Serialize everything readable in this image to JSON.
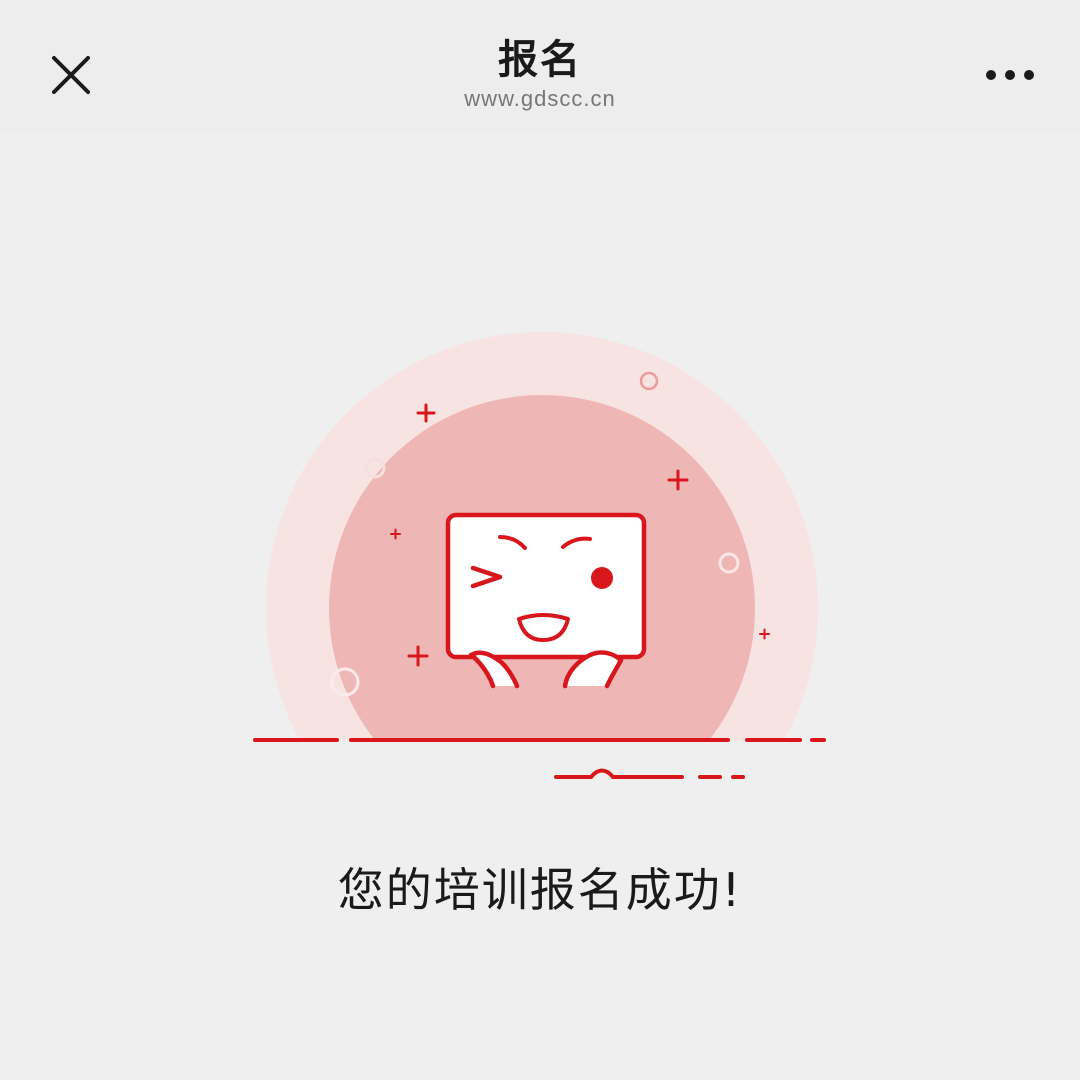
{
  "nav": {
    "title": "报名",
    "url": "www.gdscc.cn",
    "close_icon": "close-icon",
    "more_icon": "more-icon"
  },
  "main": {
    "illustration_icon": "winking-mascot-icon",
    "message": "您的培训报名成功!"
  },
  "colors": {
    "accent": "#d9161c",
    "circle_outer": "#f8e3e3",
    "circle_inner": "#efb6b6",
    "background": "#efefef",
    "nav_background": "#ededed"
  }
}
